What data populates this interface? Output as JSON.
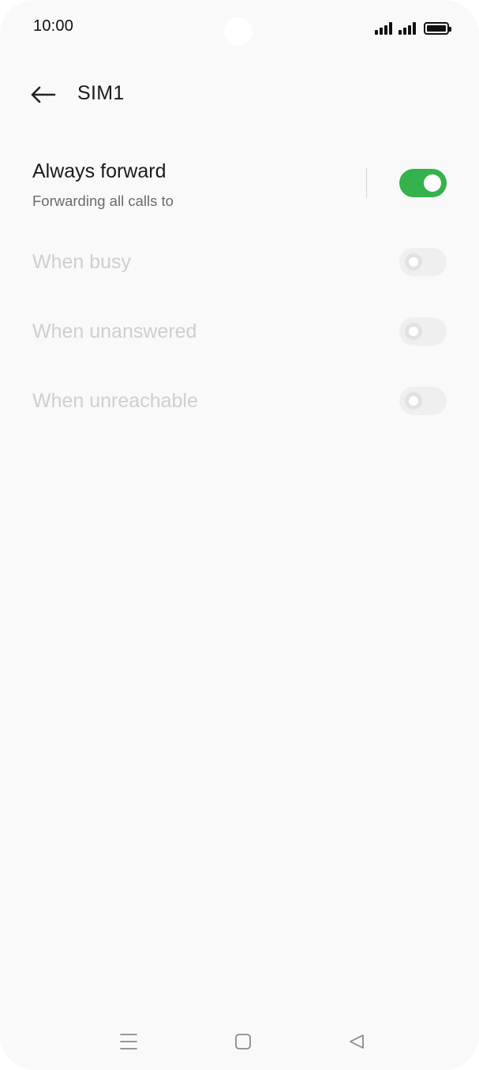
{
  "status_bar": {
    "time": "10:00",
    "icons": [
      "signal-sim1-icon",
      "signal-sim2-icon",
      "battery-icon"
    ]
  },
  "header": {
    "back_icon": "arrow-left-icon",
    "title": "SIM1"
  },
  "forwarding_options": [
    {
      "title": "Always forward",
      "subtitle": "Forwarding all calls to",
      "enabled": true,
      "toggle_on": true
    },
    {
      "title": "When busy",
      "enabled": false,
      "toggle_on": false
    },
    {
      "title": "When unanswered",
      "enabled": false,
      "toggle_on": false
    },
    {
      "title": "When unreachable",
      "enabled": false,
      "toggle_on": false
    }
  ],
  "nav_bar": {
    "icons": [
      "menu-icon",
      "home-icon",
      "back-triangle-icon"
    ]
  },
  "colors": {
    "accent_green": "#34b24b",
    "background": "#f9f9f9",
    "disabled_text": "#cfcfcf"
  }
}
